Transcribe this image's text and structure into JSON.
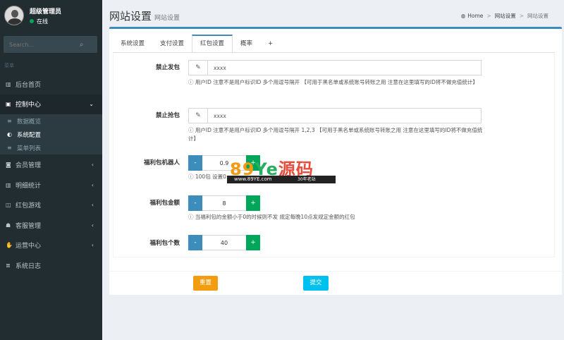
{
  "sidebar": {
    "user": {
      "name": "超级管理员",
      "status": "在线"
    },
    "search_placeholder": "Search...",
    "menu_header": "菜单",
    "nav": [
      {
        "label": "后台首页",
        "icon": "bar-chart-icon",
        "glyph": "▥",
        "caret": ""
      },
      {
        "label": "控制中心",
        "icon": "dashboard-icon",
        "glyph": "▣",
        "caret": "⌄",
        "active": true
      },
      {
        "label": "会员管理",
        "icon": "user-card-icon",
        "glyph": "◙",
        "caret": "‹"
      },
      {
        "label": "明细统计",
        "icon": "bar-chart-icon",
        "glyph": "▥",
        "caret": "‹"
      },
      {
        "label": "红包游戏",
        "icon": "gamepad-icon",
        "glyph": "◫",
        "caret": "‹"
      },
      {
        "label": "客服管理",
        "icon": "users-icon",
        "glyph": "☗",
        "caret": "‹"
      },
      {
        "label": "运营中心",
        "icon": "hand-icon",
        "glyph": "✋",
        "caret": "‹"
      },
      {
        "label": "系统日志",
        "icon": "database-icon",
        "glyph": "≣",
        "caret": ""
      }
    ],
    "sub_items": [
      {
        "label": "数据概览",
        "icon": "list-icon",
        "glyph": "≡"
      },
      {
        "label": "系统配置",
        "icon": "toggle-icon",
        "glyph": "◐",
        "active": true
      },
      {
        "label": "菜单列表",
        "icon": "list-icon",
        "glyph": "≡"
      }
    ]
  },
  "header": {
    "title": "网站设置",
    "subtitle": "网站设置",
    "breadcrumb": {
      "home": "Home",
      "level1": "网站设置",
      "level2": "网站设置"
    }
  },
  "tabs": [
    "系统设置",
    "支付设置",
    "红包设置",
    "概率",
    "+"
  ],
  "form": {
    "ban_send": {
      "label": "禁止发包",
      "value": "xxxx",
      "help": "用户ID 注意不是用户标识ID 多个用逗号隔开 【可用于黑名单或系统账号转账之用 注意在这里填写的ID将不做充值统计】"
    },
    "ban_grab": {
      "label": "禁止抢包",
      "value": "xxxx",
      "help": "用户ID 注意不是用户标识ID 多个用逗号隔开 1,2,3 【可用于黑名单或系统账号转账之用 注意在这里填写的ID将不做充值统计】"
    },
    "robot": {
      "label": "福利包机器人",
      "value": "0.9",
      "help": "100包 设置0"
    },
    "amount": {
      "label": "福利包金额",
      "value": "8",
      "help": "当福利包的金额小于0的时候则不发 规定每晚10点发规定金额的红包"
    },
    "count": {
      "label": "福利包个数",
      "value": "40"
    },
    "minus": "-",
    "plus": "+"
  },
  "buttons": {
    "reset": "重置",
    "submit": "提交"
  },
  "watermark": {
    "main_a": "89",
    "main_b": "Ye",
    "main_c": "源码",
    "url": "www.89YE.com",
    "tag": "30年老站"
  },
  "colors": {
    "sidebar": "#222d32",
    "primary": "#3c8dbc",
    "success": "#00a65a",
    "warning": "#f39c12",
    "info": "#00c0ef"
  }
}
